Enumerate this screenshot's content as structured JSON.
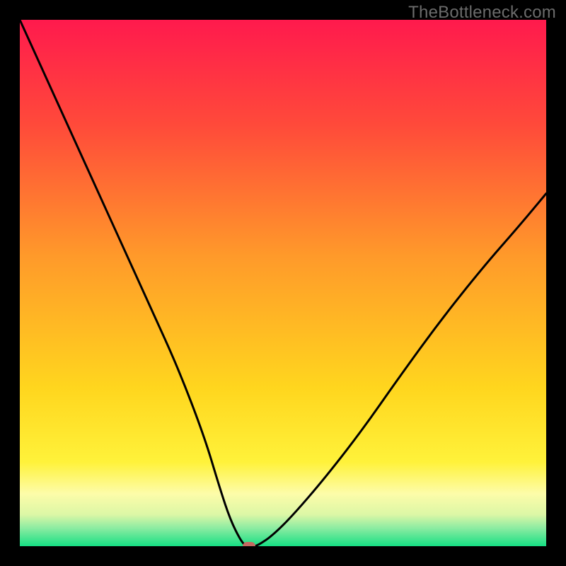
{
  "watermark": "TheBottleneck.com",
  "chart_data": {
    "type": "line",
    "title": "",
    "xlabel": "",
    "ylabel": "",
    "x_range": [
      0,
      100
    ],
    "y_range": [
      0,
      100
    ],
    "curve": {
      "name": "bottleneck-curve",
      "x": [
        0,
        5,
        10,
        15,
        20,
        25,
        30,
        35,
        38,
        40,
        42,
        43,
        44,
        45,
        48,
        52,
        58,
        65,
        72,
        80,
        88,
        95,
        100
      ],
      "y": [
        100,
        89,
        78,
        67,
        56,
        45,
        34,
        21,
        11,
        5,
        1,
        0,
        0,
        0,
        2,
        6,
        13,
        22,
        32,
        43,
        53,
        61,
        67
      ]
    },
    "marker": {
      "x": 43.5,
      "y": 0
    },
    "background_gradient": [
      {
        "stop": 0.0,
        "color": "#ff1a4d"
      },
      {
        "stop": 0.2,
        "color": "#ff4a3a"
      },
      {
        "stop": 0.45,
        "color": "#ff9a2a"
      },
      {
        "stop": 0.7,
        "color": "#ffd61e"
      },
      {
        "stop": 0.84,
        "color": "#fff23a"
      },
      {
        "stop": 0.9,
        "color": "#fdfca9"
      },
      {
        "stop": 0.94,
        "color": "#dcf7a6"
      },
      {
        "stop": 0.965,
        "color": "#8eeca2"
      },
      {
        "stop": 1.0,
        "color": "#16df84"
      }
    ]
  }
}
